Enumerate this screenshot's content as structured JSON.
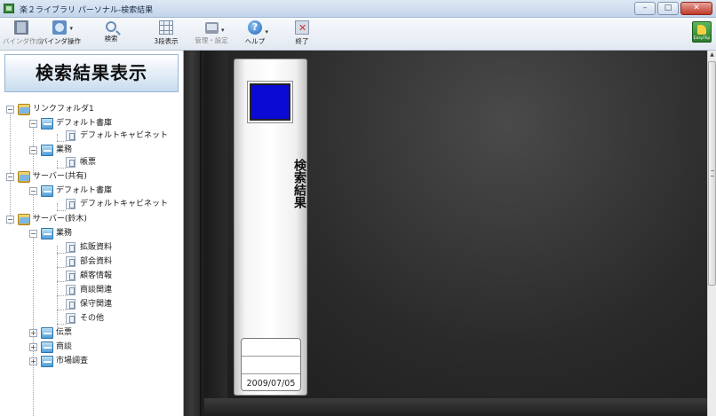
{
  "window": {
    "title": "楽２ライブラリ パーソナル-検索結果",
    "controls": [
      "minimize",
      "maximize",
      "close"
    ]
  },
  "toolbar": {
    "items": [
      {
        "label": "バインダ作成",
        "icon": "binder-new-icon",
        "enabled": false
      },
      {
        "label": "バインダ操作",
        "icon": "binder-operate-icon",
        "enabled": true
      },
      {
        "label": "検索",
        "icon": "search-icon",
        "enabled": true
      },
      {
        "label": "3段表示",
        "icon": "grid-icon",
        "enabled": true
      },
      {
        "label": "管理・設定",
        "icon": "admin-icon",
        "enabled": false
      },
      {
        "label": "ヘルプ",
        "icon": "help-icon",
        "enabled": true
      },
      {
        "label": "終了",
        "icon": "exit-icon",
        "enabled": true
      }
    ],
    "easyflip_label": "EasyFlip"
  },
  "left_pane": {
    "header": "検索結果表示",
    "tree": [
      {
        "label": "リンクフォルダ1",
        "type": "folder",
        "expanded": true
      },
      {
        "label": "デフォルト書庫",
        "type": "shelf",
        "expanded": true
      },
      {
        "label": "デフォルトキャビネット",
        "type": "cabinet"
      },
      {
        "label": "業務",
        "type": "shelf",
        "expanded": true
      },
      {
        "label": "帳票",
        "type": "cabinet"
      },
      {
        "label": "サーバー(共有)",
        "type": "folder",
        "expanded": true
      },
      {
        "label": "デフォルト書庫",
        "type": "shelf",
        "expanded": true
      },
      {
        "label": "デフォルトキャビネット",
        "type": "cabinet"
      },
      {
        "label": "サーバー(鈴木)",
        "type": "folder",
        "expanded": true
      },
      {
        "label": "業務",
        "type": "shelf",
        "expanded": true
      },
      {
        "label": "拡販資料",
        "type": "cabinet"
      },
      {
        "label": "部会資料",
        "type": "cabinet"
      },
      {
        "label": "顧客情報",
        "type": "cabinet"
      },
      {
        "label": "商談関連",
        "type": "cabinet"
      },
      {
        "label": "保守関連",
        "type": "cabinet"
      },
      {
        "label": "その他",
        "type": "cabinet"
      },
      {
        "label": "伝票",
        "type": "shelf",
        "expanded": false
      },
      {
        "label": "商談",
        "type": "shelf",
        "expanded": false
      },
      {
        "label": "市場調査",
        "type": "shelf",
        "expanded": false
      }
    ]
  },
  "binder": {
    "title": "検索結果",
    "color": "#0a0ad4",
    "date": "2009/07/05"
  }
}
